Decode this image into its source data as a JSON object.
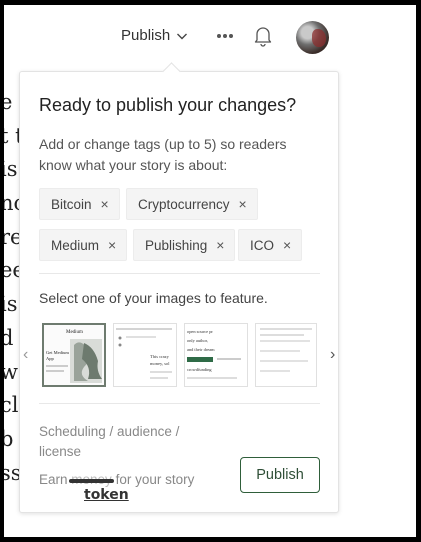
{
  "background_text": [
    "e n",
    "t t",
    "is",
    "nc",
    "re",
    "ee",
    "is",
    "d",
    "wo",
    "cl",
    "b",
    "ss"
  ],
  "topbar": {
    "publish_label": "Publish",
    "icons": [
      "chevron-down-icon",
      "more-options-icon",
      "bell-icon",
      "avatar"
    ]
  },
  "popover": {
    "title": "Ready to publish your changes?",
    "description": "Add or change tags (up to 5) so readers know what your story is about:",
    "tags": [
      {
        "label": "Bitcoin",
        "remove": "×"
      },
      {
        "label": "Cryptocurrency",
        "remove": "×"
      },
      {
        "label": "Medium",
        "remove": "×"
      },
      {
        "label": "Publishing",
        "remove": "×"
      },
      {
        "label": "ICO",
        "remove": "×"
      }
    ],
    "feature_label": "Select one of your images to feature.",
    "thumbnails": [
      {
        "lines": [
          "Medium",
          "Get Medium",
          "App"
        ],
        "selected": true
      },
      {
        "lines": [
          "This crazy",
          "money, sol"
        ],
        "selected": false
      },
      {
        "lines": [
          "open source pr",
          "only author,",
          "and their dream",
          "crowdfunding"
        ],
        "selected": false
      },
      {
        "lines": [],
        "selected": false
      }
    ],
    "prev_arrow": "‹",
    "next_arrow": "›",
    "scheduling_link": "Scheduling / audience / license",
    "earn_prefix": "Earn ",
    "earn_struck": "money",
    "earn_suffix": " for your story",
    "earn_correction": "token",
    "publish_button": "Publish"
  },
  "colors": {
    "publish_green": "#2f5e3a",
    "tag_bg": "#f4f4f4",
    "muted_text": "#888888"
  }
}
